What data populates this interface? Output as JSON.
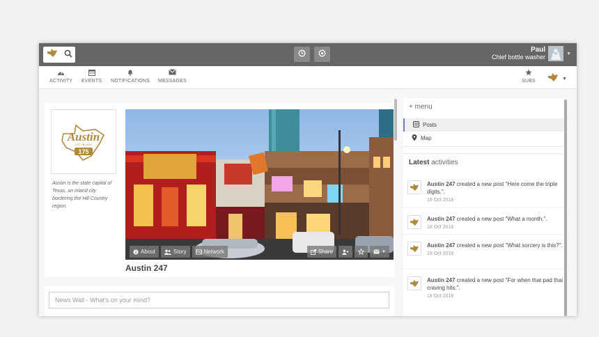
{
  "topbar": {
    "user_name": "Paul",
    "user_role": "Chief bottle washer"
  },
  "nav": {
    "activity": "ACTIVITY",
    "events": "EVENTS",
    "notifications": "NOTIFICATIONS",
    "messages": "MESSAGES",
    "subs": "SUBS"
  },
  "profile": {
    "description": "Austin is the state capital of Texas, an inland city bordering the Hill Country region.",
    "title": "Austin 247",
    "logo_text": "Austin",
    "logo_number": "175",
    "logo_small": "EST. ★ 1839"
  },
  "cover_tabs": {
    "about": "About",
    "story": "Story",
    "network": "Network",
    "share": "Share"
  },
  "wall": {
    "placeholder": "News Wall - What's on your mind?"
  },
  "sidebar": {
    "menu_title": "menu",
    "posts": "Posts",
    "map": "Map",
    "latest_bold": "Latest",
    "latest_rest": "activities"
  },
  "activities": [
    {
      "who": "Austin 247",
      "text": "created a new post \"Here come the triple digits.\".",
      "date": "18 Oct 2018"
    },
    {
      "who": "Austin 247",
      "text": "created a new post \"What a month.\".",
      "date": "18 Oct 2018"
    },
    {
      "who": "Austin 247",
      "text": "created a new post \"What sorcery is this?\".",
      "date": "18 Oct 2018"
    },
    {
      "who": "Austin 247",
      "text": "created a new post \"For when that pad thai craving hits.\".",
      "date": "18 Oct 2018"
    }
  ],
  "colors": {
    "topbar": "#666666",
    "brand_gold": "#b08a3c",
    "active_border": "#6a7fb5"
  }
}
